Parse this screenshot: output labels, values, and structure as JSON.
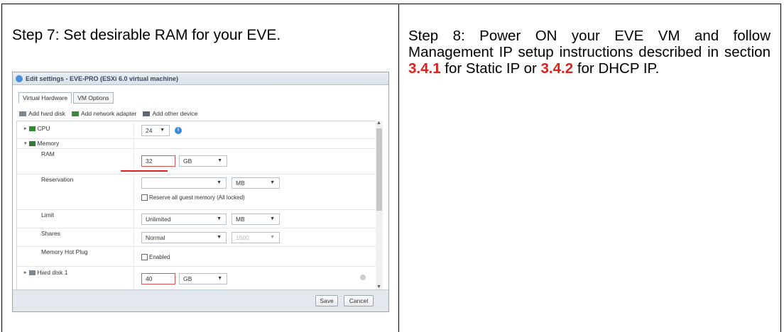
{
  "left_cell": {
    "step_text": "Step 7: Set desirable RAM for your EVE."
  },
  "right_cell": {
    "text_part1": "Step 8: Power ON your EVE VM and follow Management IP setup instructions described in section ",
    "ref1": "3.4.1",
    "text_part2": " for Static IP or ",
    "ref2": "3.4.2",
    "text_part3": " for DHCP IP."
  },
  "dialog": {
    "title": "Edit settings - EVE-PRO (ESXi 6.0 virtual machine)",
    "tabs": [
      "Virtual Hardware",
      "VM Options"
    ],
    "toolbar": {
      "add_hard_disk": "Add hard disk",
      "add_network_adapter": "Add network adapter",
      "add_other_device": "Add other device"
    },
    "cpu": {
      "label": "CPU",
      "value": "24"
    },
    "memory": {
      "label": "Memory",
      "ram_label": "RAM",
      "ram_value": "32",
      "ram_unit": "GB",
      "reservation_label": "Reservation",
      "reservation_value": "",
      "reservation_unit": "MB",
      "reserve_all_label": "Reserve all guest memory (All locked)",
      "limit_label": "Limit",
      "limit_value": "Unlimited",
      "limit_unit": "MB",
      "shares_label": "Shares",
      "shares_value": "Normal",
      "shares_number": "1600",
      "hot_plug_label": "Memory Hot Plug",
      "hot_plug_checkbox": "Enabled"
    },
    "hard_disk": {
      "label": "Hard disk 1",
      "value": "40",
      "unit": "GB"
    },
    "buttons": {
      "save": "Save",
      "cancel": "Cancel"
    }
  },
  "colors": {
    "ref_red": "#e0201b",
    "underline_red": "#e02020"
  }
}
